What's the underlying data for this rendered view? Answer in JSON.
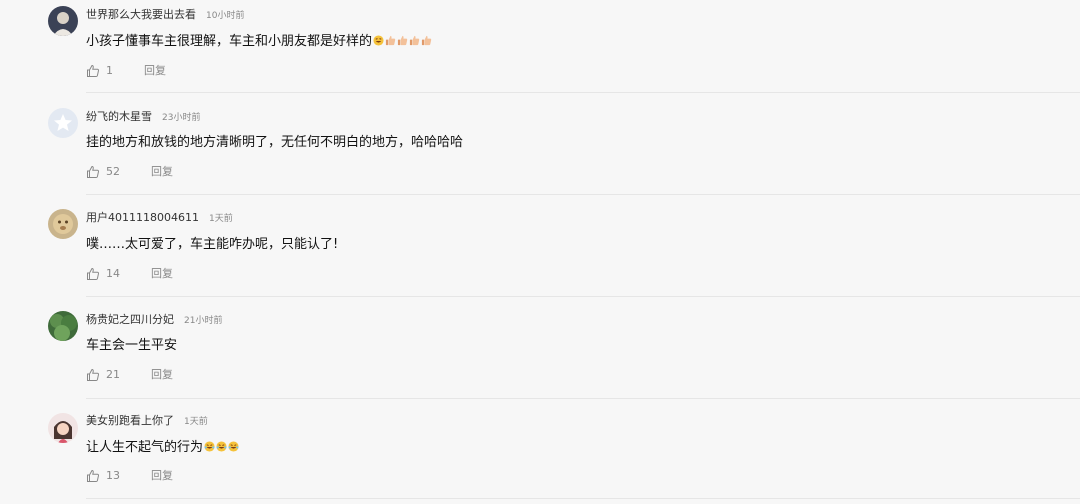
{
  "comments": [
    {
      "username": "世界那么大我要出去看",
      "time": "10小时前",
      "text": "小孩子懂事车主很理解，车主和小朋友都是好样的",
      "emojis": [
        "grin-emoji",
        "thumbs-up-emoji",
        "thumbs-up-emoji",
        "thumbs-up-emoji",
        "thumbs-up-emoji"
      ],
      "likes": "1",
      "reply_label": "回复"
    },
    {
      "username": "纷飞的木星雪",
      "time": "23小时前",
      "text": "挂的地方和放钱的地方清晰明了，无任何不明白的地方，哈哈哈哈",
      "emojis": [],
      "likes": "52",
      "reply_label": "回复"
    },
    {
      "username": "用户4011118004611",
      "time": "1天前",
      "text": "噗……太可爱了，车主能咋办呢，只能认了!",
      "emojis": [],
      "likes": "14",
      "reply_label": "回复"
    },
    {
      "username": "杨贵妃之四川分妃",
      "time": "21小时前",
      "text": "车主会一生平安",
      "emojis": [],
      "likes": "21",
      "reply_label": "回复"
    },
    {
      "username": "美女别跑看上你了",
      "time": "1天前",
      "text": "让人生不起气的行为",
      "emojis": [
        "laugh-cry-emoji",
        "laugh-cry-emoji",
        "laugh-cry-emoji"
      ],
      "likes": "13",
      "reply_label": "回复"
    }
  ]
}
